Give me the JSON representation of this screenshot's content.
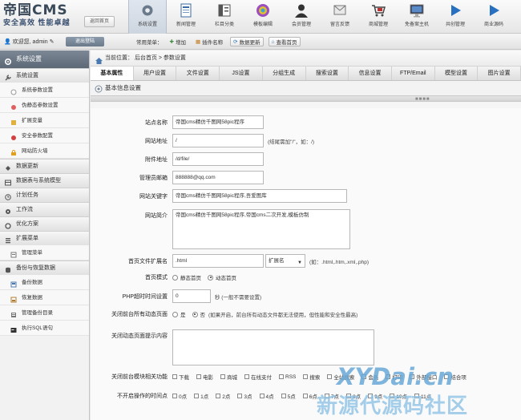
{
  "logo": {
    "title": "帝国CMS",
    "slogan": "安全高效  性能卓越"
  },
  "home_button": "返回首页",
  "topnav": [
    {
      "label": "系统设置",
      "icon": "gear-icon",
      "active": true
    },
    {
      "label": "新闻管理",
      "icon": "document-icon"
    },
    {
      "label": "栏目分类",
      "icon": "column-icon"
    },
    {
      "label": "模板编辑",
      "icon": "template-icon"
    },
    {
      "label": "会员管理",
      "icon": "user-icon"
    },
    {
      "label": "留言反馈",
      "icon": "feedback-icon"
    },
    {
      "label": "商城管理",
      "icon": "cart-icon"
    },
    {
      "label": "免备案主机",
      "icon": "monitor-icon"
    },
    {
      "label": "共创管理",
      "icon": "play-icon"
    },
    {
      "label": "商业源码",
      "icon": "play-icon"
    }
  ],
  "userbar": {
    "welcome": "欢迎您, admin",
    "logout": "退出登陆",
    "shortcut_label": "常用菜单：",
    "shortcuts": [
      "增加",
      "插件名称",
      "数据更新",
      "查看首页"
    ]
  },
  "sidebar": {
    "head": "系统设置",
    "groups": [
      {
        "label": "系统设置",
        "icon": "wrench-icon",
        "items": [
          {
            "label": "系统参数设置",
            "icon": "circle-icon"
          },
          {
            "label": "伪静态参数设置",
            "icon": "link-icon"
          },
          {
            "label": "扩展变量",
            "icon": "brush-icon"
          },
          {
            "label": "安全参数配置",
            "icon": "shield-icon"
          },
          {
            "label": "网站防火墙",
            "icon": "lock-icon"
          }
        ]
      },
      {
        "label": "数据更新",
        "icon": "refresh-icon",
        "items": []
      },
      {
        "label": "数据表与系统模型",
        "icon": "table-icon",
        "items": []
      },
      {
        "label": "计划任务",
        "icon": "clock-icon",
        "items": []
      },
      {
        "label": "工作流",
        "icon": "flow-icon",
        "items": []
      },
      {
        "label": "优化方案",
        "icon": "optimize-icon",
        "items": []
      },
      {
        "label": "扩展菜单",
        "icon": "menu-icon",
        "items": [
          {
            "label": "管理菜单",
            "icon": "list-icon"
          }
        ]
      },
      {
        "label": "备份与恢复数据",
        "icon": "database-icon",
        "items": [
          {
            "label": "备份数据",
            "icon": "backup-icon"
          },
          {
            "label": "恢复数据",
            "icon": "restore-icon"
          },
          {
            "label": "管理备份目录",
            "icon": "folder-icon"
          },
          {
            "label": "执行SQL语句",
            "icon": "sql-icon"
          }
        ]
      }
    ]
  },
  "breadcrumb": {
    "prefix": "当前位置：",
    "path": "后台首页 > 参数设置"
  },
  "tabs": [
    "基本属性",
    "用户设置",
    "文件设置",
    "JS设置",
    "分组生成",
    "搜索设置",
    "信息设置",
    "FTP/Email",
    "模型设置",
    "图片设置"
  ],
  "section_title": "基本信息设置",
  "form": {
    "site_name": {
      "label": "站点名称",
      "value": "帝国cms精仿千图网58pic程序"
    },
    "site_url": {
      "label": "网站地址",
      "value": "/",
      "hint": "(结尾需加\"/\"，如：/)"
    },
    "attach_url": {
      "label": "附件地址",
      "value": "/d/file/"
    },
    "admin_email": {
      "label": "管理员邮箱",
      "value": "888888@qq.com"
    },
    "keywords": {
      "label": "网站关键字",
      "value": "帝国cms精仿千图网58pic程序,吾爱图库"
    },
    "intro": {
      "label": "网站简介",
      "value": "帝国cms精仿千图网58pic程序,帝国cms二次开发,模板仿制"
    },
    "home_ext": {
      "label": "首页文件扩展名",
      "value": ".html",
      "select": "扩展名",
      "hint": "(如：.html,.htm,.xml,.php)"
    },
    "home_mode": {
      "label": "首页模式",
      "options": [
        "静态首页",
        "动态首页"
      ],
      "selected": 1
    },
    "php_timeout": {
      "label": "PHP超时时间设置",
      "value": "0",
      "hint": "秒 (一般不需要设置)"
    },
    "close_front": {
      "label": "关闭前台所有动态页面",
      "options": [
        "是",
        "否"
      ],
      "selected": 1,
      "hint": "(如果开启，前台所有动态文件都无法使用，但性能和安全性最高)"
    },
    "close_tip": {
      "label": "关闭动态页面提示内容",
      "value": ""
    },
    "close_modules": {
      "label": "关闭前台模块相关功能",
      "options": [
        "下载",
        "电影",
        "商城",
        "在线支付",
        "RSS",
        "搜索",
        "全站搜索",
        "会员",
        "打印",
        "外部接口",
        "结合项"
      ]
    },
    "close_hours": {
      "label": "不开启操作的时间点",
      "options": [
        "0点",
        "1点",
        "2点",
        "3点",
        "4点",
        "5点",
        "6点",
        "7点",
        "8点",
        "9点",
        "10点",
        "11点"
      ]
    }
  },
  "watermark": {
    "line1": "XYDai.cn",
    "line2": "新源代源码社区"
  }
}
